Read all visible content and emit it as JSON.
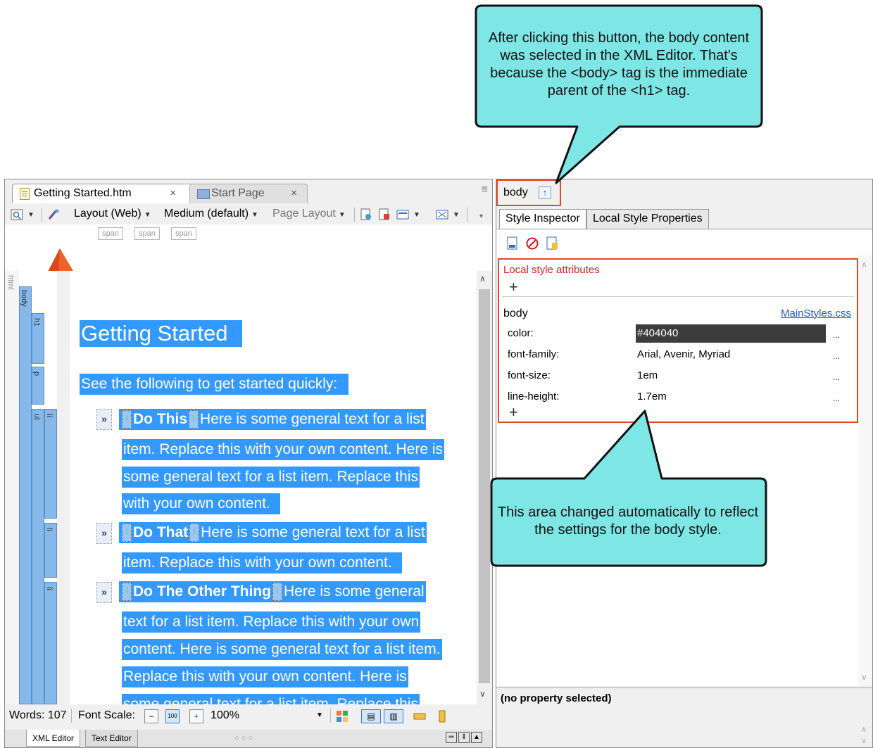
{
  "callouts": {
    "top": "After clicking this button, the body content was selected in the XML Editor. That's because the <body> tag is the immediate parent of the <h1> tag.",
    "bottom": "This area changed automatically to reflect the settings for the body style."
  },
  "editor": {
    "tabs": [
      {
        "label": "Getting Started.htm",
        "close": "×"
      },
      {
        "label": "Start Page",
        "close": "×"
      }
    ],
    "toolbar": {
      "layout": "Layout (Web)",
      "medium": "Medium (default)",
      "page_layout": "Page Layout"
    },
    "span_tags": [
      "span",
      "span",
      "span"
    ],
    "structure_labels": {
      "html": "html",
      "body": "body",
      "h1": "h1",
      "p": "p",
      "ul": "ul",
      "li": "li"
    },
    "heading": "Getting Started",
    "intro": "See the following to get started quickly:",
    "list_items": [
      {
        "bold": "Do This",
        "first_line": "Here is some general text for a list",
        "lines": [
          "item. Replace this with your own content. Here is",
          "some general text for a list item. Replace this",
          "with your own content."
        ]
      },
      {
        "bold": "Do That",
        "first_line": "Here is some general text for a list",
        "lines": [
          "item. Replace this with your own content."
        ]
      },
      {
        "bold": "Do The Other Thing",
        "first_line": "Here is some general",
        "lines": [
          "text for a list item. Replace this with your own",
          "content. Here is some general text for a list item.",
          "Replace this with your own content. Here is",
          "some general text for a list item. Replace this"
        ]
      }
    ],
    "bullet_glyph": "»",
    "status": {
      "words": "Words: 107",
      "font_scale_label": "Font Scale:",
      "zoom": "100%"
    },
    "editor_tabs": [
      "XML Editor",
      "Text Editor"
    ]
  },
  "inspector": {
    "element_tag": "body",
    "tabs": [
      "Style Inspector",
      "Local Style Properties"
    ],
    "local_title": "Local style attributes",
    "style_name": "body",
    "style_file": "MainStyles.css",
    "properties": [
      {
        "name": "color:",
        "value": "#404040",
        "more": "..."
      },
      {
        "name": "font-family:",
        "value": "Arial, Avenir, Myriad",
        "more": "..."
      },
      {
        "name": "font-size:",
        "value": "1em",
        "more": "..."
      },
      {
        "name": "line-height:",
        "value": "1.7em",
        "more": "..."
      }
    ],
    "status": "(no property selected)"
  },
  "colors": {
    "callout_fill": "#7fe6e6",
    "highlight_border": "#e04a2c",
    "selection": "#3399ff",
    "link": "#1a5fc4"
  }
}
